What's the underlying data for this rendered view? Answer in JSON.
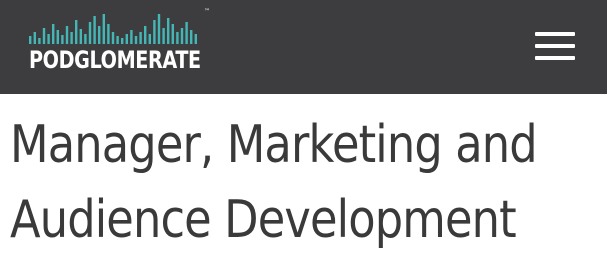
{
  "brand": {
    "name": "PODGLOMERATE",
    "trademark": "™",
    "accent_color": "#45b6b6",
    "header_color": "#3d3d3f",
    "logo_icon": "audio-waveform"
  },
  "navigation": {
    "menu_icon": "hamburger-menu-icon"
  },
  "page": {
    "title_line1": "Manager, Marketing and",
    "title_line2": "Audience Development"
  }
}
